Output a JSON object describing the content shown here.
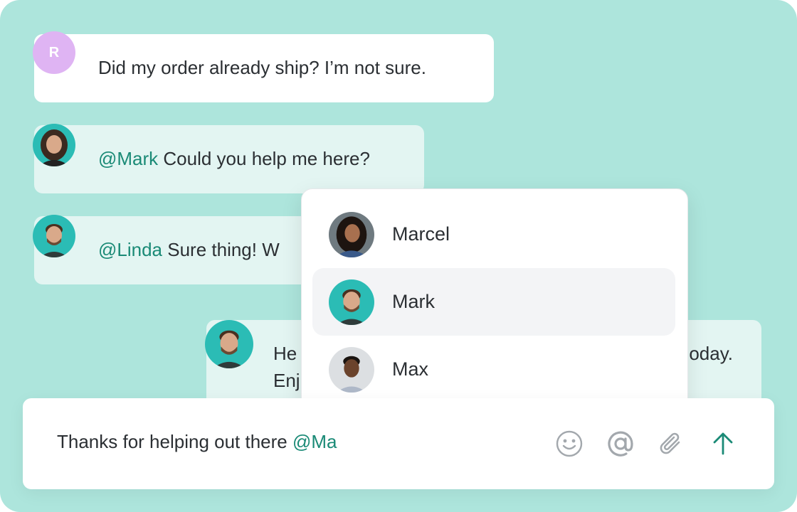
{
  "messages": [
    {
      "avatar_letter": "R",
      "text": "Did my order already ship? I’m not sure.",
      "mention": ""
    },
    {
      "mention": "@Mark",
      "text": " Could you help me here?"
    },
    {
      "mention": "@Linda",
      "text": " Sure thing! W"
    },
    {
      "line1": "He",
      "line1_end": "oday.",
      "line2": "Enj"
    }
  ],
  "mention_dropdown": {
    "items": [
      {
        "name": "Marcel",
        "avatar": "marcel-avatar"
      },
      {
        "name": "Mark",
        "avatar": "mark-avatar",
        "selected": true
      },
      {
        "name": "Max",
        "avatar": "max-avatar"
      }
    ]
  },
  "composer": {
    "text": "Thanks for helping out there ",
    "mention_fragment": "@Ma",
    "tools": [
      "emoji-icon",
      "at-sign-icon",
      "paperclip-icon",
      "send-arrow-icon"
    ]
  },
  "colors": {
    "background": "#ade5dc",
    "mention": "#1a8a76",
    "tinted_bubble": "#e3f5f2",
    "avatar_teal": "#2bbcb5",
    "letter_avatar": "#dfb4f3"
  }
}
